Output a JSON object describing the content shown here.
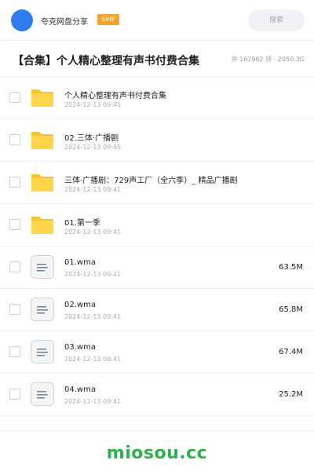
{
  "header": {
    "username": "夸克网盘分享",
    "badge": "SVIP",
    "search_placeholder": "搜索",
    "colors": {
      "avatar": "#2f7bf0",
      "badge": "#f6a32a"
    }
  },
  "page": {
    "title": "【合集】个人精心整理有声书付费合集",
    "stats": "共 162902 项 · 2050.3G"
  },
  "files": [
    {
      "type": "folder",
      "icon": "folder-icon",
      "name": "个人精心整理有声书付费合集",
      "date": "2024-12-13 09:45",
      "size": ""
    },
    {
      "type": "folder",
      "icon": "folder-icon",
      "name": "02.三体·广播剧",
      "date": "2024-12-13 09:45",
      "size": ""
    },
    {
      "type": "folder",
      "icon": "folder-icon",
      "name": "三体·广播剧：729声工厂（全六季）_ 精品广播剧",
      "date": "2024-12-13 09:41",
      "size": ""
    },
    {
      "type": "folder",
      "icon": "folder-icon",
      "name": "01.第一季",
      "date": "2024-12-13 09:41",
      "size": ""
    },
    {
      "type": "file",
      "icon": "audio-file-icon",
      "name": "01.wma",
      "date": "2024-12-13 09:41",
      "size": "63.5M"
    },
    {
      "type": "file",
      "icon": "audio-file-icon",
      "name": "02.wma",
      "date": "2024-12-13 09:41",
      "size": "65.8M"
    },
    {
      "type": "file",
      "icon": "audio-file-icon",
      "name": "03.wma",
      "date": "2024-12-13 09:41",
      "size": "67.4M"
    },
    {
      "type": "file",
      "icon": "audio-file-icon",
      "name": "04.wma",
      "date": "2024-12-13 09:41",
      "size": "25.2M"
    }
  ],
  "watermark": "miosou.cc"
}
